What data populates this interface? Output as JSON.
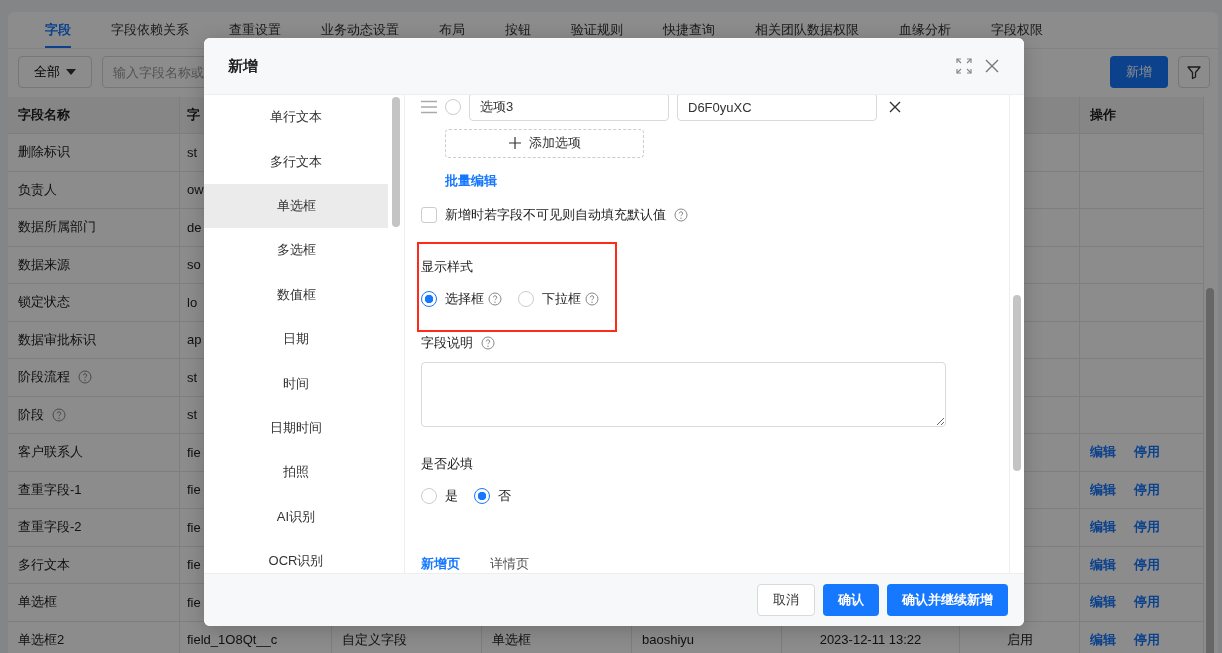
{
  "tabs": [
    {
      "label": "字段",
      "selected": true
    },
    {
      "label": "字段依赖关系",
      "selected": false
    },
    {
      "label": "查重设置",
      "selected": false
    },
    {
      "label": "业务动态设置",
      "selected": false
    },
    {
      "label": "布局",
      "selected": false
    },
    {
      "label": "按钮",
      "selected": false
    },
    {
      "label": "验证规则",
      "selected": false
    },
    {
      "label": "快捷查询",
      "selected": false
    },
    {
      "label": "相关团队数据权限",
      "selected": false
    },
    {
      "label": "血缘分析",
      "selected": false
    },
    {
      "label": "字段权限",
      "selected": false
    }
  ],
  "toolbar": {
    "filter": "全部",
    "search_placeholder": "输入字段名称或",
    "add_button": "新增"
  },
  "table": {
    "columns": [
      "字段名称",
      "字",
      null,
      null,
      null,
      null,
      null,
      "操作"
    ],
    "rows": [
      {
        "cells": [
          "删除标识",
          "st",
          null,
          null,
          null,
          null,
          null
        ],
        "actions": []
      },
      {
        "cells": [
          "负责人",
          "ow",
          null,
          null,
          null,
          null,
          null
        ],
        "actions": []
      },
      {
        "cells": [
          "数据所属部门",
          "de",
          null,
          null,
          null,
          null,
          null
        ],
        "actions": []
      },
      {
        "cells": [
          "数据来源",
          "so",
          null,
          null,
          null,
          null,
          null
        ],
        "actions": []
      },
      {
        "cells": [
          "锁定状态",
          "lo",
          null,
          null,
          null,
          null,
          null
        ],
        "actions": []
      },
      {
        "cells": [
          "数据审批标识",
          "ap",
          null,
          null,
          null,
          null,
          null
        ],
        "actions": []
      },
      {
        "help": true,
        "cells": [
          "阶段流程",
          "st",
          null,
          null,
          null,
          null,
          null
        ],
        "actions": []
      },
      {
        "help": true,
        "cells": [
          "阶段",
          "st",
          null,
          null,
          null,
          null,
          null
        ],
        "actions": []
      },
      {
        "cells": [
          "客户联系人",
          "fie",
          null,
          null,
          null,
          null,
          null
        ],
        "actions": [
          "编辑",
          "停用"
        ]
      },
      {
        "cells": [
          "查重字段-1",
          "fie",
          null,
          null,
          null,
          null,
          null
        ],
        "actions": [
          "编辑",
          "停用"
        ]
      },
      {
        "cells": [
          "查重字段-2",
          "fie",
          null,
          null,
          null,
          null,
          null
        ],
        "actions": [
          "编辑",
          "停用"
        ]
      },
      {
        "cells": [
          "多行文本",
          "fie",
          null,
          null,
          null,
          null,
          null
        ],
        "actions": [
          "编辑",
          "停用"
        ]
      },
      {
        "cells": [
          "单选框",
          "fie",
          null,
          null,
          null,
          null,
          null
        ],
        "actions": [
          "编辑",
          "停用"
        ]
      },
      {
        "cells": [
          "单选框2",
          "field_1O8Qt__c",
          "自定义字段",
          "单选框",
          "baoshiyu",
          "2023-12-11 13:22",
          "启用"
        ],
        "actions": [
          "编辑",
          "停用"
        ]
      }
    ]
  },
  "modal": {
    "title": "新增",
    "field_types": [
      {
        "label": "单行文本",
        "selected": false
      },
      {
        "label": "多行文本",
        "selected": false
      },
      {
        "label": "单选框",
        "selected": true
      },
      {
        "label": "多选框",
        "selected": false
      },
      {
        "label": "数值框",
        "selected": false
      },
      {
        "label": "日期",
        "selected": false
      },
      {
        "label": "时间",
        "selected": false
      },
      {
        "label": "日期时间",
        "selected": false
      },
      {
        "label": "拍照",
        "selected": false
      },
      {
        "label": "AI识别",
        "selected": false
      },
      {
        "label": "OCR识别",
        "selected": false
      }
    ],
    "options": [
      {
        "label": "选项3",
        "value": "D6F0yuXC",
        "selected": false
      }
    ],
    "add_option": "添加选项",
    "batch_edit": "批量编辑",
    "autofill": {
      "label": "新增时若字段不可见则自动填充默认值",
      "checked": false
    },
    "display_style": {
      "label": "显示样式",
      "options": [
        {
          "label": "选择框",
          "selected": true
        },
        {
          "label": "下拉框",
          "selected": false
        }
      ]
    },
    "description": {
      "label": "字段说明"
    },
    "required": {
      "label": "是否必填",
      "options": [
        {
          "label": "是",
          "selected": false
        },
        {
          "label": "否",
          "selected": true
        }
      ]
    },
    "page_tabs": [
      {
        "label": "新增页",
        "selected": true
      },
      {
        "label": "详情页",
        "selected": false
      }
    ],
    "buttons": [
      {
        "label": "取消",
        "kind": "default"
      },
      {
        "label": "确认",
        "kind": "primary"
      },
      {
        "label": "确认并继续新增",
        "kind": "primary"
      }
    ]
  }
}
